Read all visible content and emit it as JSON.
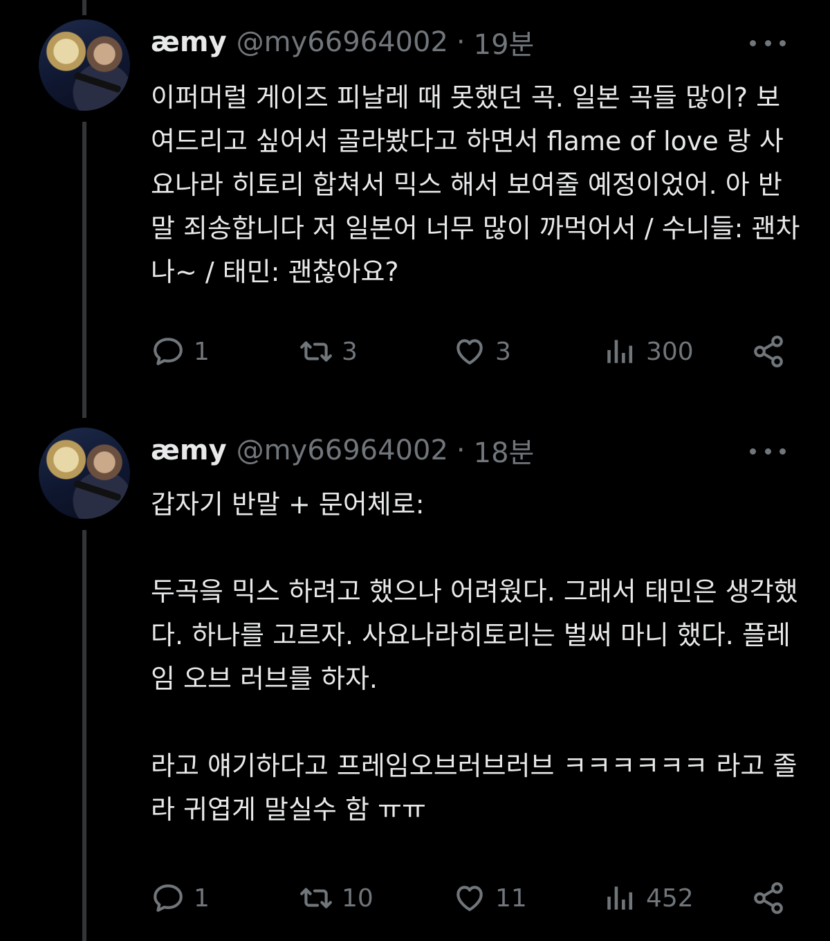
{
  "tweets": [
    {
      "name": "æmy",
      "handle": "@my66964002",
      "separator": "·",
      "time": "19분",
      "text": "이퍼머럴 게이즈 피날레 때 못했던 곡. 일본 곡들 많이? 보여드리고 싶어서 골라봤다고 하면서 flame of love 랑 사요나라 히토리 합쳐서 믹스 해서 보여줄 예정이었어. 아 반말 죄송합니다 저 일본어 너무 많이 까먹어서 / 수니들: 괜차나~ / 태민: 괜찮아요?",
      "replies": "1",
      "retweets": "3",
      "likes": "3",
      "views": "300"
    },
    {
      "name": "æmy",
      "handle": "@my66964002",
      "separator": "·",
      "time": "18분",
      "text": "갑자기 반말 + 문어체로:\n\n두곡읔 믹스 하려고 했으나 어려웠다. 그래서 태민은 생각했다. 하나를 고르자. 사요나라히토리는 벌써 마니 했다. 플레임 오브 러브를 하자.\n\n라고 얘기하다고 프레임오브러브러브 ㅋㅋㅋㅋㅋㅋ 라고 졸라 귀엽게 말실수 함 ㅠㅠ",
      "replies": "1",
      "retweets": "10",
      "likes": "11",
      "views": "452"
    }
  ],
  "icons": {
    "reply": "reply-bubble-icon",
    "retweet": "retweet-arrows-icon",
    "like": "heart-icon",
    "views": "views-bar-chart-icon",
    "share": "share-nodes-icon",
    "more": "more-dots-icon"
  },
  "colors": {
    "background": "#000000",
    "text": "#e7e9ea",
    "muted": "#71767b",
    "thread_line": "#333639"
  }
}
